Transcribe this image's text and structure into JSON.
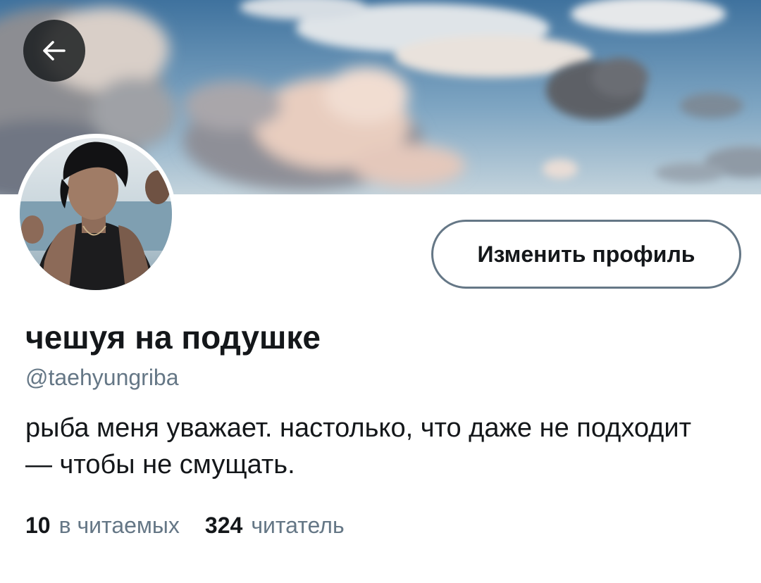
{
  "header": {
    "back_icon": "arrow-left-icon",
    "banner_image": "sky-with-clouds"
  },
  "profile": {
    "avatar_image": "person-portrait-by-sea",
    "edit_button_label": "Изменить профиль",
    "display_name": "чешуя на подушке",
    "handle": "@taehyungriba",
    "bio": "рыба меня уважает. настолько, что даже не подходит — чтобы не смущать."
  },
  "stats": [
    {
      "count": "10",
      "label": "в читаемых"
    },
    {
      "count": "324",
      "label": "читатель"
    }
  ],
  "colors": {
    "text_primary": "#14171a",
    "text_secondary": "#657786",
    "button_border": "#657786",
    "back_button_bg": "#14171a"
  }
}
